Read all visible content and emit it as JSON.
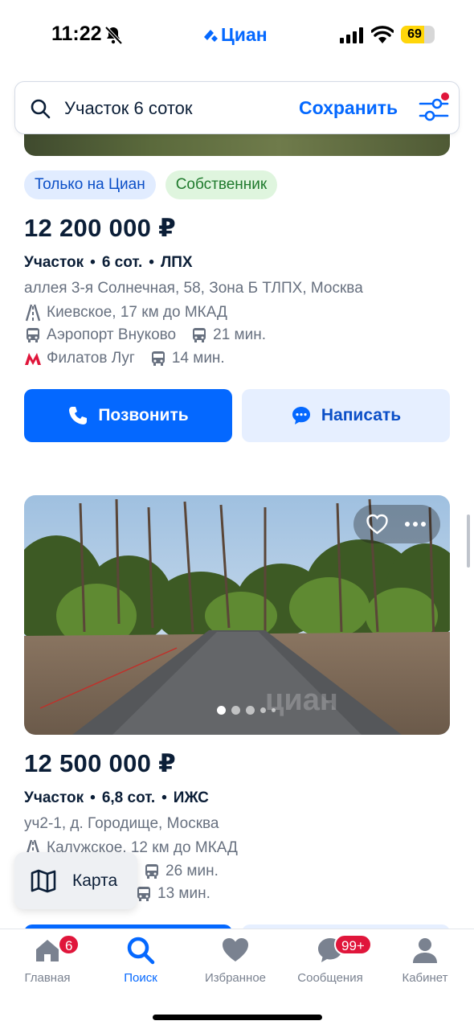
{
  "status_bar": {
    "time": "11:22",
    "brand": "Циан",
    "battery_percent": "69",
    "battery_level": 0.69
  },
  "search": {
    "query": "Участок 6 соток",
    "save_label": "Сохранить"
  },
  "listing1": {
    "badges": [
      "Только на Циан",
      "Собственник"
    ],
    "price": "12 200 000 ₽",
    "params": [
      "Участок",
      "6 сот.",
      "ЛПХ"
    ],
    "address": "аллея 3-я Солнечная, 58, Зона Б ТЛПХ, Москва",
    "highway": "Киевское, 17 км до МКАД",
    "station1": {
      "name": "Аэропорт Внуково",
      "time": "21 мин."
    },
    "station2": {
      "name": "Филатов Луг",
      "time": "14 мин."
    },
    "call_label": "Позвонить",
    "write_label": "Написать"
  },
  "listing2": {
    "price": "12 500 000 ₽",
    "params": [
      "Участок",
      "6,8 сот.",
      "ИЖС"
    ],
    "address": "уч2-1, д. Городище, Москва",
    "highway": "Калужское, 12 км до МКАД",
    "station1": {
      "time": "26 мин."
    },
    "station2": {
      "time": "13 мин."
    },
    "watermark": "циан"
  },
  "map_button": {
    "label": "Карта"
  },
  "tabs": [
    {
      "label": "Главная",
      "badge": "6"
    },
    {
      "label": "Поиск"
    },
    {
      "label": "Избранное"
    },
    {
      "label": "Сообщения",
      "badge": "99+"
    },
    {
      "label": "Кабинет"
    }
  ],
  "colors": {
    "accent": "#0468ff",
    "badge_red": "#e0163b",
    "metro_red": "#e0163b"
  }
}
